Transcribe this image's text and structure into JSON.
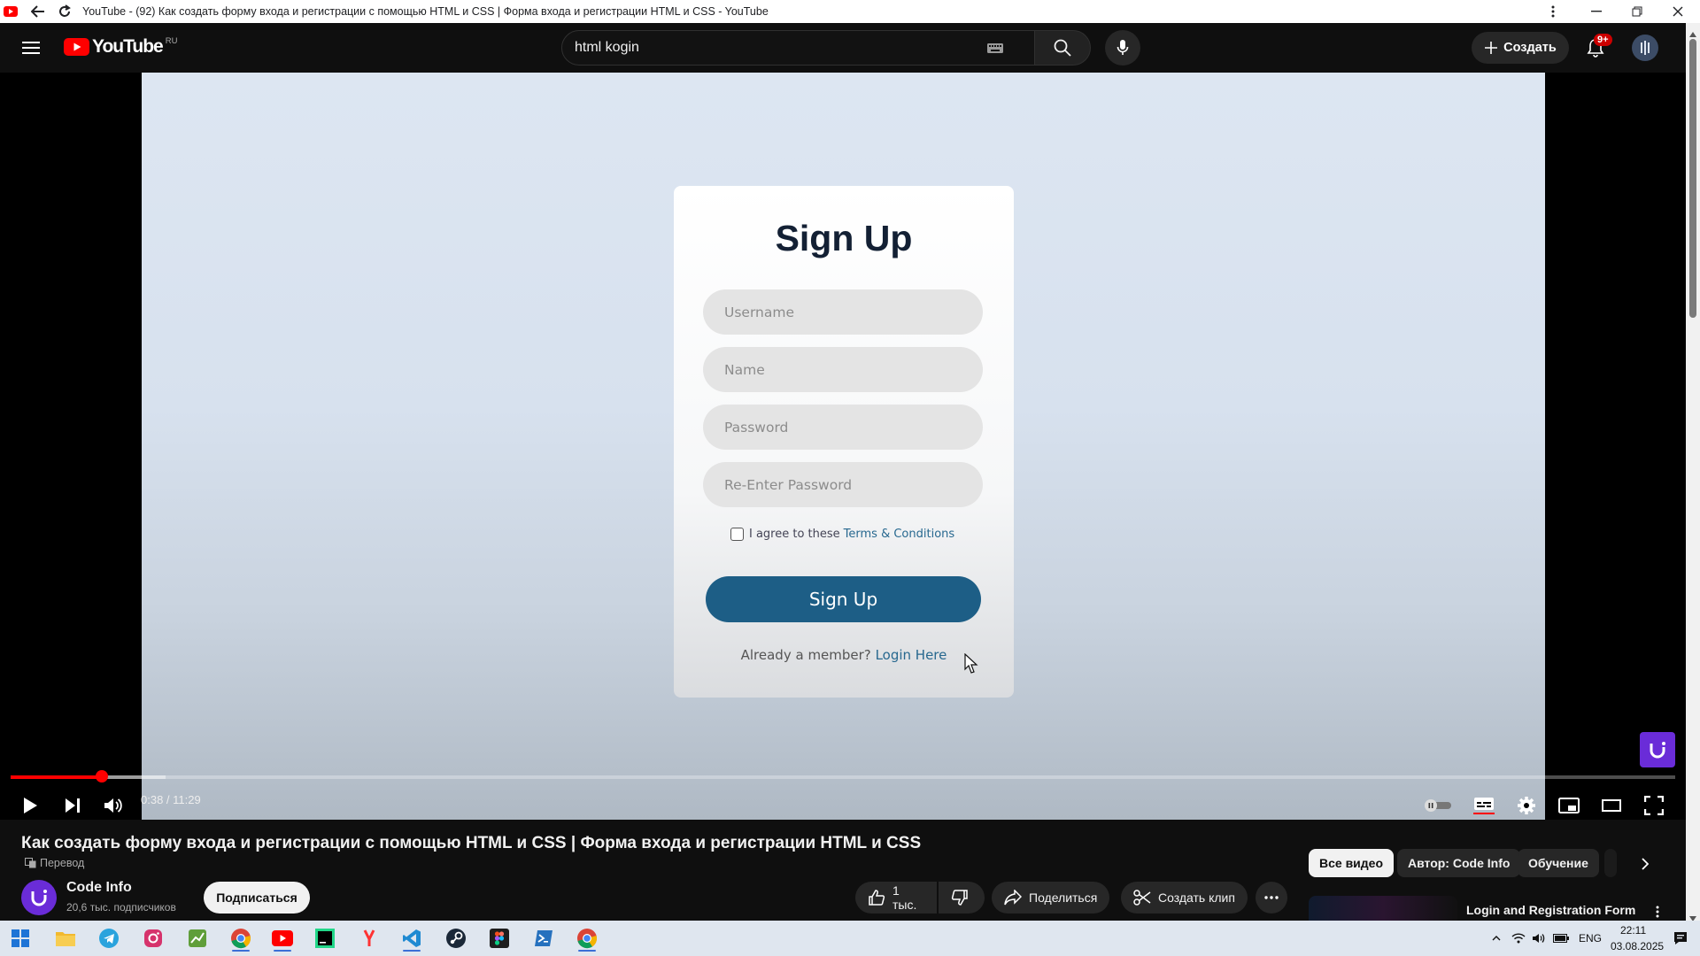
{
  "browser": {
    "title": "YouTube - (92) Как создать форму входа и регистрации с помощью HTML и CSS | Форма входа и регистрации HTML и CSS - YouTube"
  },
  "masthead": {
    "logo_text": "YouTube",
    "logo_region": "RU",
    "search_value": "html kogin",
    "create_label": "Создать",
    "notification_badge": "9+"
  },
  "video_frame": {
    "title": "Sign Up",
    "fields": [
      "Username",
      "Name",
      "Password",
      "Re-Enter Password"
    ],
    "agree_text": "I agree to these",
    "terms_link": "Terms & Conditions",
    "submit_label": "Sign Up",
    "member_text": "Already a member?",
    "login_link": "Login Here"
  },
  "player": {
    "current_time": "0:38",
    "duration": "11:29",
    "time_display": "0:38 / 11:29",
    "progress_fraction": 0.055,
    "buffer_fraction": 0.093
  },
  "below": {
    "video_title": "Как создать форму входа и регистрации с помощью HTML и CSS | Форма входа и регистрации HTML и CSS",
    "translate_label": "Перевод",
    "channel_name": "Code Info",
    "channel_subs": "20,6 тыс. подписчиков",
    "subscribe_label": "Подписаться",
    "likes": "1 тыс.",
    "share_label": "Поделиться",
    "clip_label": "Создать клип",
    "chips": [
      "Все видео",
      "Автор: Code Info",
      "Обучение"
    ],
    "rec_title": "Login and Registration Form"
  },
  "taskbar": {
    "lang": "ENG",
    "time": "22:11",
    "date": "03.08.2025"
  },
  "colors": {
    "accent": "#ff0000",
    "form_button": "#1d5e86",
    "link": "#27688f"
  }
}
